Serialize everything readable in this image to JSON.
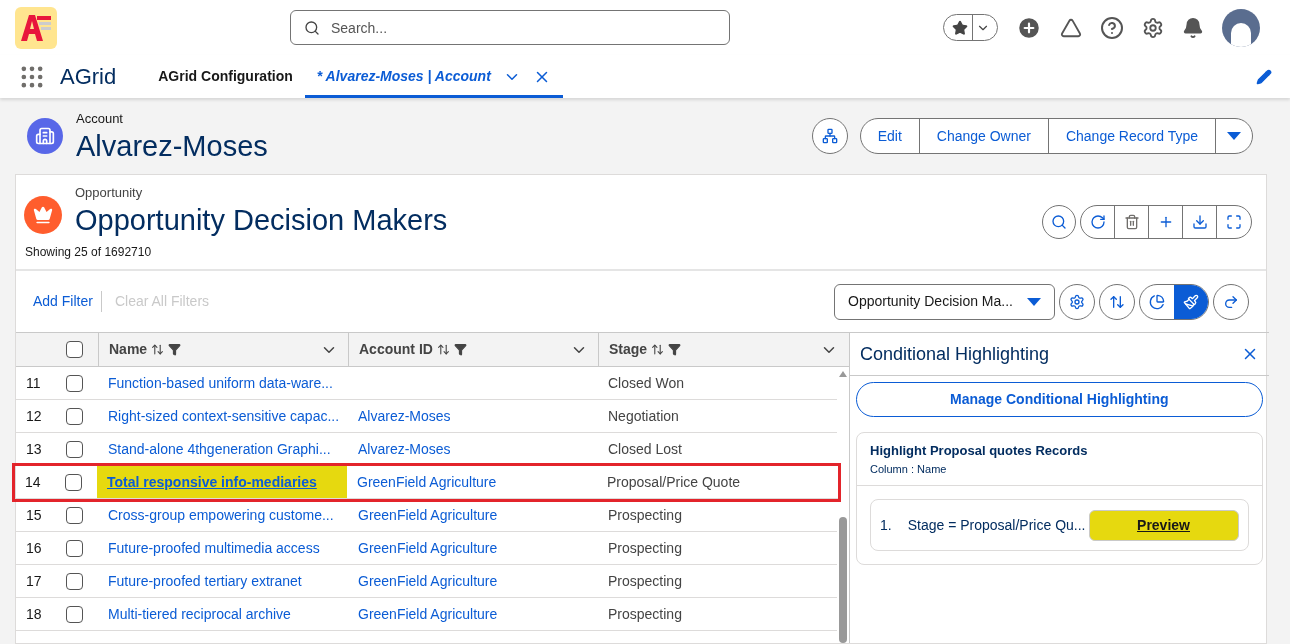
{
  "global_header": {
    "search": {
      "placeholder": "Search..."
    }
  },
  "nav": {
    "app_name": "AGrid",
    "tabs": [
      {
        "label": "AGrid Configuration",
        "selected": false,
        "closable": false
      },
      {
        "label": "* Alvarez-Moses | Account",
        "selected": true,
        "closable": true
      }
    ]
  },
  "record": {
    "object": "Account",
    "title": "Alvarez-Moses",
    "actions": [
      "Edit",
      "Change Owner",
      "Change Record Type"
    ]
  },
  "grid": {
    "object": "Opportunity",
    "title": "Opportunity Decision Makers",
    "count": "Showing 25 of 1692710",
    "filters": {
      "add": "Add Filter",
      "clear": "Clear All Filters",
      "clear_disabled": true
    },
    "view_select": "Opportunity Decision Ma...",
    "columns": [
      "Name",
      "Account ID",
      "Stage"
    ],
    "select_all_checked": false,
    "rows": [
      {
        "num": "11",
        "name": "Function-based uniform data-ware...",
        "account": "",
        "stage": "Closed Won",
        "highlighted": false,
        "checked": false
      },
      {
        "num": "12",
        "name": "Right-sized context-sensitive capac...",
        "account": "Alvarez-Moses",
        "stage": "Negotiation",
        "highlighted": false,
        "checked": false
      },
      {
        "num": "13",
        "name": "Stand-alone 4thgeneration Graphi...",
        "account": "Alvarez-Moses",
        "stage": "Closed Lost",
        "highlighted": false,
        "checked": false
      },
      {
        "num": "14",
        "name": "Total responsive info-mediaries",
        "account": "GreenField Agriculture",
        "stage": "Proposal/Price Quote",
        "highlighted": true,
        "checked": false
      },
      {
        "num": "15",
        "name": "Cross-group empowering custome...",
        "account": "GreenField Agriculture",
        "stage": "Prospecting",
        "highlighted": false,
        "checked": false
      },
      {
        "num": "16",
        "name": "Future-proofed multimedia access",
        "account": "GreenField Agriculture",
        "stage": "Prospecting",
        "highlighted": false,
        "checked": false
      },
      {
        "num": "17",
        "name": "Future-proofed tertiary extranet",
        "account": "GreenField Agriculture",
        "stage": "Prospecting",
        "highlighted": false,
        "checked": false
      },
      {
        "num": "18",
        "name": "Multi-tiered reciprocal archive",
        "account": "GreenField Agriculture",
        "stage": "Prospecting",
        "highlighted": false,
        "checked": false
      }
    ]
  },
  "panel": {
    "title": "Conditional Highlighting",
    "manage_button": "Manage Conditional Highlighting",
    "rule": {
      "title": "Highlight Proposal quotes Records",
      "column": "Column : Name",
      "conditions": [
        {
          "num": "1.",
          "text": "Stage = Proposal/Price Qu...",
          "preview": "Preview",
          "color": "#e6d90f"
        }
      ]
    }
  }
}
